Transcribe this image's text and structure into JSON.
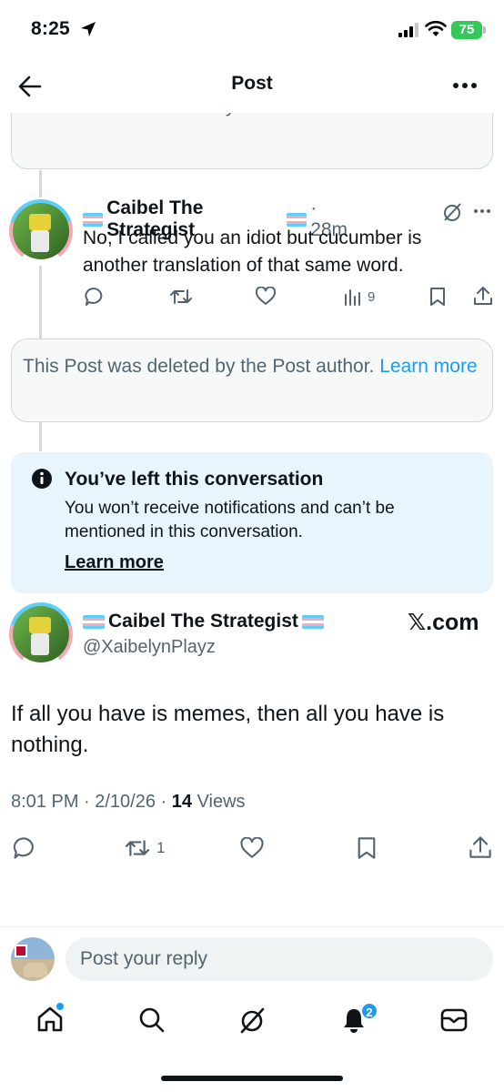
{
  "status_bar": {
    "time": "8:25",
    "battery": "75"
  },
  "header": {
    "title": "Post"
  },
  "deleted_top": {
    "text": "This Post was deleted by the Post author.",
    "link": "Learn more"
  },
  "reply_post": {
    "author": "Caibel The Strategist",
    "time": "· 28m",
    "text": "No, I called you an idiot but cucumber is another translation of that same word.",
    "views": "9"
  },
  "deleted_mid": {
    "text": "This Post was deleted by the Post author.",
    "link": "Learn more"
  },
  "notice": {
    "title": "You’ve left this conversation",
    "body": "You won’t receive notifications and can’t be mentioned in this conversation.",
    "link": "Learn more"
  },
  "main_post": {
    "author": "Caibel The Strategist",
    "handle": "@XaibelynPlayz",
    "watermark": "𝕏.com",
    "text": "If all you have is memes, then all you have is nothing.",
    "timestamp": "8:01 PM · 2/10/26 · ",
    "views_count": "14",
    "views_label": " Views",
    "retweets": "1"
  },
  "reply_bar": {
    "placeholder": "Post your reply"
  },
  "tab_bar": {
    "notifications_badge": "2"
  },
  "colors": {
    "accent": "#1d9bf0",
    "text": "#0f1419",
    "secondary": "#536471",
    "notice_bg": "#e8f5fd"
  }
}
